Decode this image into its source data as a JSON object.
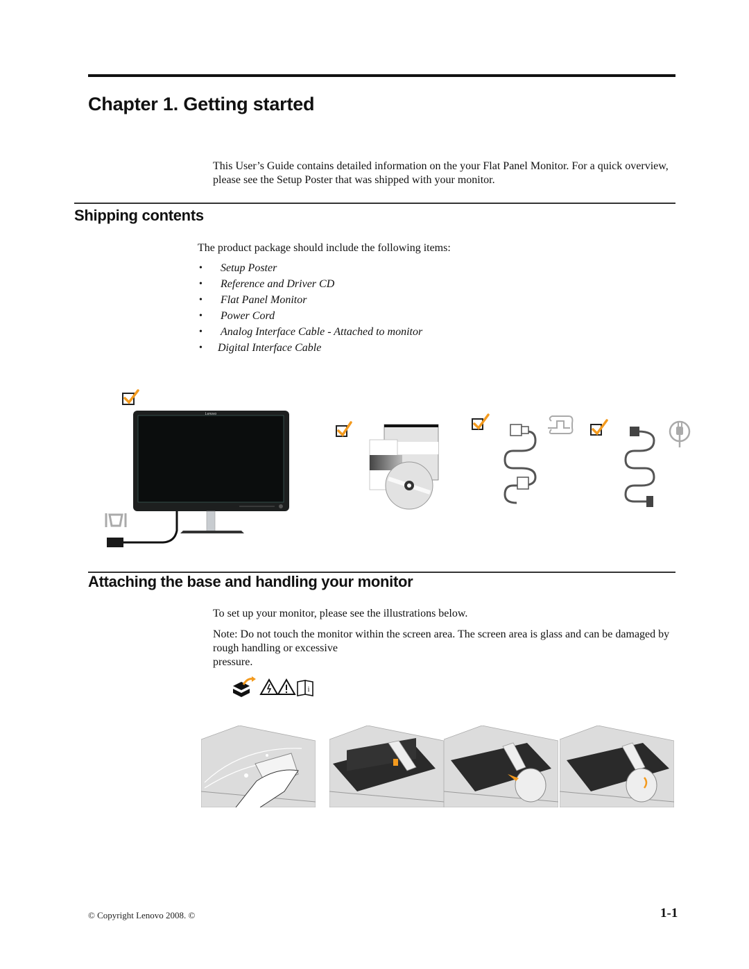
{
  "chapter": {
    "title": "Chapter 1. Getting started",
    "intro": "This User’s Guide contains detailed information on the your Flat Panel Monitor.  For a quick overview, please see the Setup Poster that was shipped with your monitor."
  },
  "shipping": {
    "heading": "Shipping contents",
    "lead": "The product package should include the following items:",
    "items": [
      "Setup Poster",
      "Reference and Driver CD",
      "Flat Panel Monitor",
      "Power Cord",
      "Analog Interface Cable - Attached to monitor",
      "Digital Interface Cable"
    ],
    "illustration": {
      "monitor_logo": "Lenovo",
      "icons": [
        "checkbox-checked-icon",
        "vga-port-icon",
        "dvi-port-icon",
        "power-plug-icon",
        "cd-icon"
      ],
      "accent_color": "#f39a1e"
    }
  },
  "attaching": {
    "heading": "Attaching the base and handling your monitor",
    "lead": "To set up your monitor, please see the illustrations below.",
    "note_label": "Note:",
    "note_text": " Do not touch the monitor within the screen area. The screen area is glass and can be damaged by rough handling or excessive",
    "note_tail": "pressure.",
    "warning_icons": [
      "unpack-box-icon",
      "electrical-hazard-icon",
      "caution-icon",
      "read-manual-icon"
    ],
    "steps": [
      "clean-screen-step",
      "attach-stand-step",
      "attach-base-step",
      "lock-base-step"
    ]
  },
  "footer": {
    "copyright": "© Copyright Lenovo 2008. ©",
    "page_number": "1-1"
  }
}
